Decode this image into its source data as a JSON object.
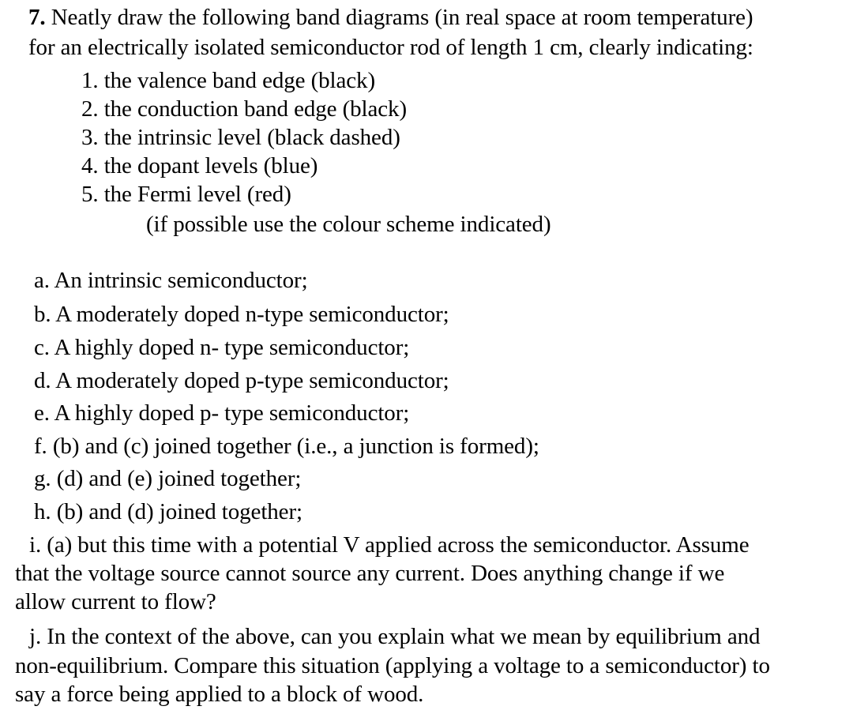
{
  "question": {
    "number": "7.",
    "intro_line1": "Neatly draw the following band diagrams (in real space at room temperature)",
    "intro_line2": "for an electrically isolated semiconductor rod of length 1 cm, clearly indicating:",
    "indicators": [
      "1. the valence band edge (black)",
      "2. the conduction band edge (black)",
      "3. the intrinsic level (black dashed)",
      "4. the dopant levels (blue)",
      "5. the Fermi level (red)"
    ],
    "colour_note": "(if possible use the colour scheme indicated)",
    "parts": [
      "a. An intrinsic semiconductor;",
      "b. A moderately doped n-type semiconductor;",
      "c. A highly doped n- type semiconductor;",
      "d. A moderately doped p-type semiconductor;",
      "e. A highly doped p- type semiconductor;",
      "f. (b) and (c) joined together (i.e., a junction is formed);",
      "g. (d) and (e) joined together;",
      "h. (b) and (d) joined together;"
    ],
    "part_i": [
      "i. (a) but this time with a potential V applied across the semiconductor. Assume",
      "that the voltage source cannot source any current. Does anything change if we",
      "allow current to flow?"
    ],
    "part_j": [
      "j. In the context of the above, can you explain what we mean by equilibrium and",
      "non-equilibrium. Compare this situation (applying a voltage to a semiconductor) to",
      "say a force being applied to a block of wood."
    ]
  }
}
